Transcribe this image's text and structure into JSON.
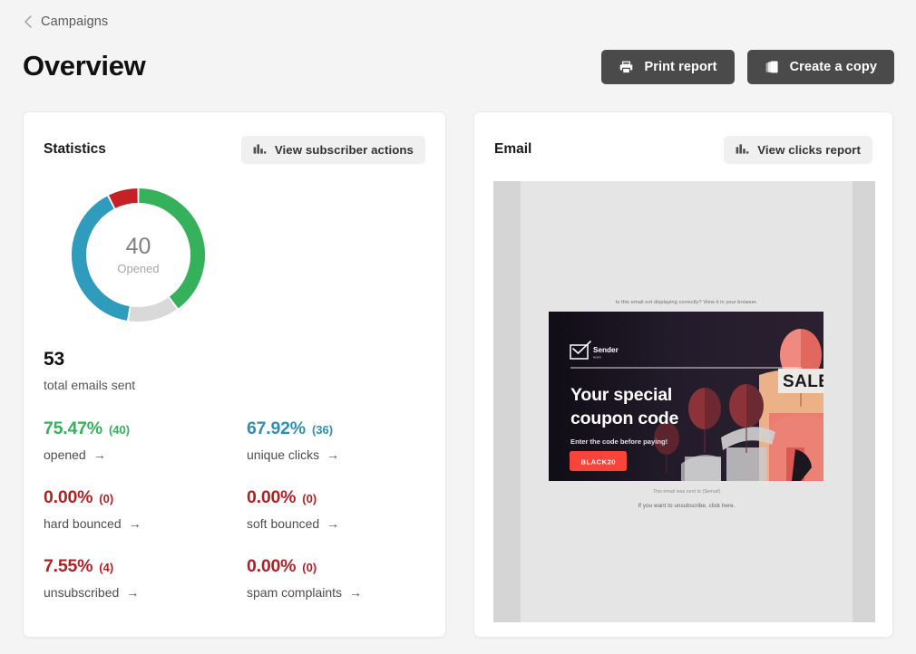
{
  "breadcrumb": {
    "label": "Campaigns",
    "icon": "chevron-left-icon"
  },
  "page": {
    "title": "Overview"
  },
  "header_actions": [
    {
      "label": "Print report",
      "icon": "printer-icon"
    },
    {
      "label": "Create a copy",
      "icon": "copy-icon"
    }
  ],
  "statistics": {
    "title": "Statistics",
    "action": {
      "label": "View subscriber actions",
      "icon": "bar-chart-icon"
    },
    "donut": {
      "center_value": "40",
      "center_label": "Opened",
      "segments": [
        {
          "name": "opened",
          "percent": 40.0,
          "color": "#35b15b"
        },
        {
          "name": "not-opened",
          "percent": 12.5,
          "color": "#d9d9d9"
        },
        {
          "name": "clicked",
          "percent": 40.0,
          "color": "#2f9bbd"
        },
        {
          "name": "unsubscribed",
          "percent": 7.5,
          "color": "#c42127"
        }
      ]
    },
    "total": {
      "value": "53",
      "label": "total emails sent"
    },
    "metrics": [
      {
        "value": "75.47%",
        "count": "(40)",
        "label": "opened",
        "color": "#35b15b",
        "arrow": "→"
      },
      {
        "value": "67.92%",
        "count": "(36)",
        "label": "unique clicks",
        "color": "#2f8fb0",
        "arrow": "→"
      },
      {
        "value": "0.00%",
        "count": "(0)",
        "label": "hard bounced",
        "color": "#b51f24",
        "arrow": "→"
      },
      {
        "value": "0.00%",
        "count": "(0)",
        "label": "soft bounced",
        "color": "#b51f24",
        "arrow": "→"
      },
      {
        "value": "7.55%",
        "count": "(4)",
        "label": "unsubscribed",
        "color": "#b51f24",
        "arrow": "→"
      },
      {
        "value": "0.00%",
        "count": "(0)",
        "label": "spam complaints",
        "color": "#b51f24",
        "arrow": "→"
      }
    ]
  },
  "email": {
    "title": "Email",
    "action": {
      "label": "View clicks report",
      "icon": "bar-chart-icon"
    },
    "preview": {
      "view_in_browser": "Is this email not displaying correctly? View it in your browser.",
      "brand_name": "Sender",
      "brand_sub": "team",
      "headline_line1": "Your special",
      "headline_line2": "coupon code",
      "subheadline": "Enter the code before paying!",
      "cta_label": "BLACK20",
      "badge": "SALE",
      "footer_line1": "This email was sent to {$email}",
      "footer_line2": "If you want to unsubscribe, click here."
    }
  },
  "colors": {
    "page_bg": "#f4f4f4",
    "card_bg": "#ffffff",
    "button_dark": "#4a4a4a",
    "button_light": "#f0f0f0",
    "green": "#35b15b",
    "blue": "#2f9bbd",
    "red": "#b51f24",
    "gray": "#d9d9d9",
    "cta_red": "#f9443c"
  },
  "chart_data": {
    "type": "pie",
    "title": "Statistics",
    "categories": [
      "opened",
      "not opened",
      "unique clicks",
      "unsubscribed"
    ],
    "values": [
      40,
      12.5,
      40,
      7.5
    ],
    "colors": [
      "#35b15b",
      "#d9d9d9",
      "#2f9bbd",
      "#c42127"
    ],
    "center_value": 40,
    "center_label": "Opened",
    "total_emails_sent": 53,
    "legend_position": "none",
    "grid": false
  }
}
